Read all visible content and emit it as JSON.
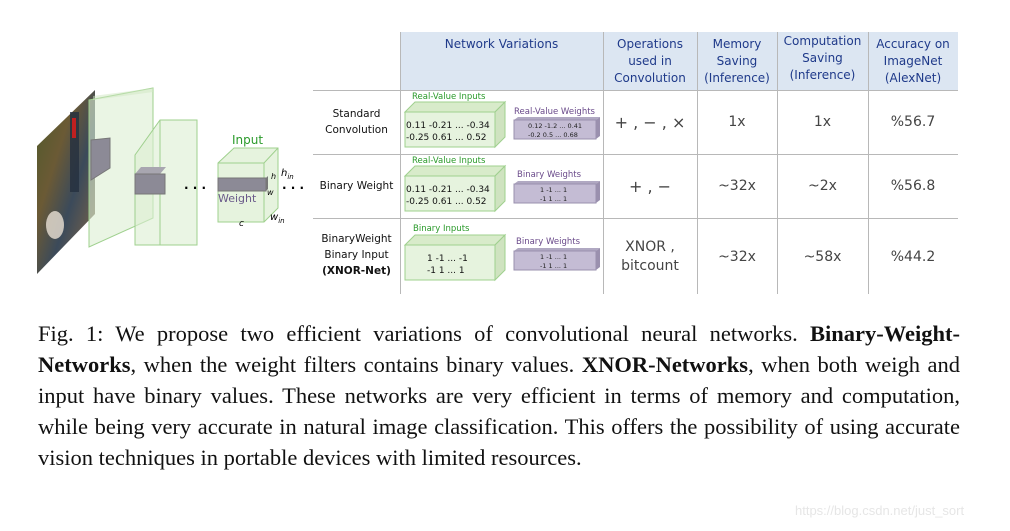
{
  "figure": {
    "input_label": "Input",
    "weight_label": "Weight",
    "dim_h": "h",
    "dim_w": "w",
    "dim_c": "c",
    "dim_h_in": "h",
    "dim_h_in_sub": "in",
    "dim_w_in": "w",
    "dim_w_in_sub": "in",
    "dots": ". . .",
    "dots2": ". . ."
  },
  "table": {
    "headers": [
      "Network Variations",
      "Operations used in Convolution",
      "Memory Saving (Inference)",
      "Computation Saving (Inference)",
      "Accuracy on ImageNet (AlexNet)"
    ],
    "rows": [
      {
        "label": "Standard Convolution",
        "input_label": "Real-Value Inputs",
        "input_line1": "0.11 -0.21 ... -0.34",
        "input_line2": "-0.25 0.61 ...  0.52",
        "weight_label": "Real-Value Weights",
        "weight_line1": "0.12 -1.2 ... 0.41",
        "weight_line2": "-0.2 0.5 ... 0.68",
        "operations": "+ , − , ×",
        "memory": "1x",
        "computation": "1x",
        "accuracy": "%56.7"
      },
      {
        "label": "Binary Weight",
        "input_label": "Real-Value Inputs",
        "input_line1": "0.11 -0.21 ... -0.34",
        "input_line2": "-0.25 0.61 ...  0.52",
        "weight_label": "Binary Weights",
        "weight_line1": "1 -1 ... 1",
        "weight_line2": "-1 1 ... 1",
        "operations": "+ , −",
        "memory": "~32x",
        "computation": "~2x",
        "accuracy": "%56.8"
      },
      {
        "label_line1": "BinaryWeight",
        "label_line2": "Binary Input",
        "label_line3": "(XNOR-Net)",
        "input_label": "Binary Inputs",
        "input_line1": "1  -1 ... -1",
        "input_line2": "-1  1 ...  1",
        "weight_label": "Binary Weights",
        "weight_line1": "1 -1 ... 1",
        "weight_line2": "-1 1 ... 1",
        "operations": "XNOR , bitcount",
        "memory": "~32x",
        "computation": "~58x",
        "accuracy": "%44.2"
      }
    ]
  },
  "caption": {
    "prefix": "Fig. 1: We propose two efficient variations of convolutional neural networks. ",
    "bold1": "Binary-Weight-Networks",
    "middle": ", when the weight filters contains binary values. ",
    "bold2": "XNOR-Networks",
    "suffix": ", when both weigh and input have binary values. These networks are very efficient in terms of memory and computation, while being very accurate in natural image classification. This offers the possibility of using accurate vision techniques in portable devices with limited resources."
  },
  "watermark": "https://blog.csdn.net/just_sort",
  "colors": {
    "header_bg": "#dce6f2",
    "header_text": "#1f3a8a",
    "input_green": "#2a9a2a",
    "weight_purple": "#6a4a8a"
  }
}
